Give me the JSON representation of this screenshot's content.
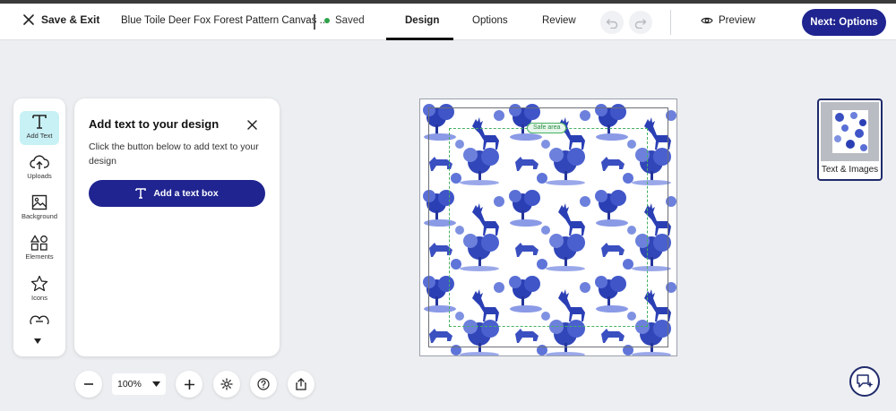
{
  "header": {
    "save_exit_label": "Save & Exit",
    "document_title": "Blue Toile Deer Fox Forest Pattern Canvas ...",
    "saved_status": "Saved",
    "tabs": [
      {
        "label": "Design",
        "active": true
      },
      {
        "label": "Options",
        "active": false
      },
      {
        "label": "Review",
        "active": false
      }
    ],
    "preview_label": "Preview",
    "next_label": "Next: Options"
  },
  "tools": [
    {
      "label": "Add Text",
      "icon": "text-t-icon",
      "active": true
    },
    {
      "label": "Uploads",
      "icon": "cloud-upload-icon",
      "active": false
    },
    {
      "label": "Background",
      "icon": "image-icon",
      "active": false
    },
    {
      "label": "Elements",
      "icon": "shapes-icon",
      "active": false
    },
    {
      "label": "Icons",
      "icon": "star-icon",
      "active": false
    },
    {
      "label": "",
      "icon": "qr-code-icon",
      "active": false
    }
  ],
  "panel": {
    "title": "Add text to your design",
    "description": "Click the button below to add text to your design",
    "button_label": "Add a text box"
  },
  "canvas": {
    "safe_area_label": "Safe area",
    "pattern_color": "#2b3fb5"
  },
  "side_thumbnail": {
    "label": "Text & Images"
  },
  "zoom": {
    "level": "100%"
  },
  "colors": {
    "brand": "#1f2490",
    "saved_dot": "#2fa34a",
    "active_tool": "#c8f1f6",
    "safe_line": "#45b062"
  }
}
